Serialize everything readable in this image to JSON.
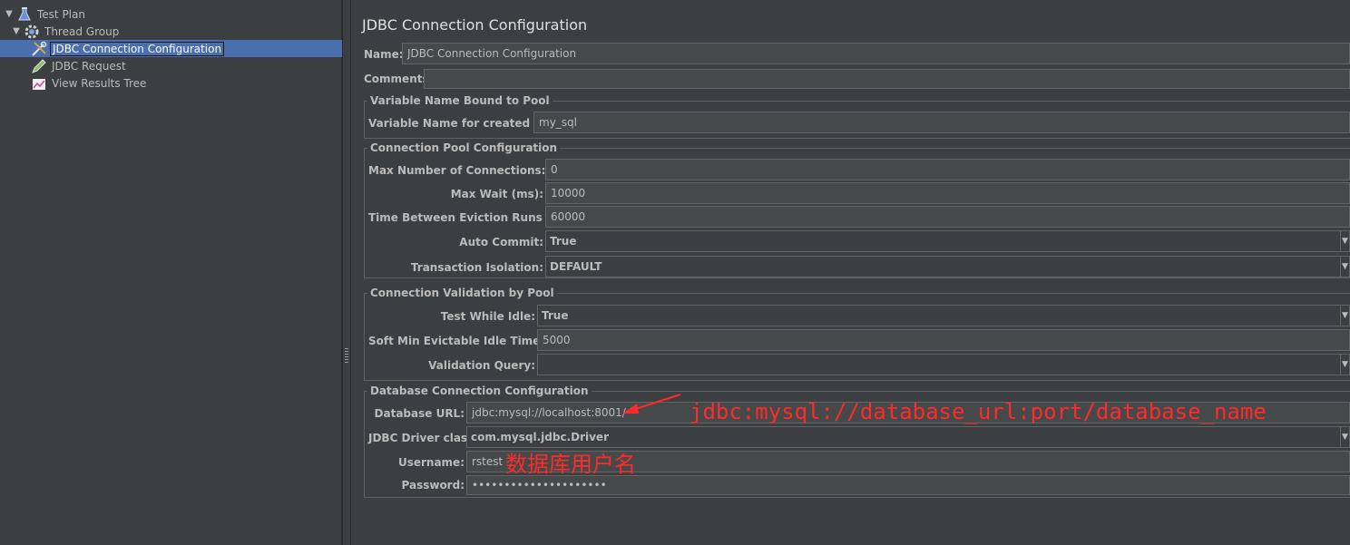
{
  "tree": {
    "items": [
      {
        "label": "Test Plan",
        "icon": "flask-icon",
        "expanded": true
      },
      {
        "label": "Thread Group",
        "icon": "gear-icon",
        "expanded": true
      },
      {
        "label": "JDBC Connection Configuration",
        "icon": "wrench-icon",
        "selected": true
      },
      {
        "label": "JDBC Request",
        "icon": "pen-icon"
      },
      {
        "label": "View Results Tree",
        "icon": "chart-icon"
      }
    ]
  },
  "config": {
    "title": "JDBC Connection Configuration",
    "name_label": "Name:",
    "name_value": "JDBC Connection Configuration",
    "comments_label": "Comments:",
    "comments_value": "",
    "var_group": {
      "title": "Variable Name Bound to Pool",
      "label": "Variable Name for created pool:",
      "value": "my_sql"
    },
    "pool_group": {
      "title": "Connection Pool Configuration",
      "max_conn_label": "Max Number of Connections:",
      "max_conn_value": "0",
      "max_wait_label": "Max Wait (ms):",
      "max_wait_value": "10000",
      "eviction_label": "Time Between Eviction Runs (ms):",
      "eviction_value": "60000",
      "autocommit_label": "Auto Commit:",
      "autocommit_value": "True",
      "isolation_label": "Transaction Isolation:",
      "isolation_value": "DEFAULT"
    },
    "validation_group": {
      "title": "Connection Validation by Pool",
      "idle_label": "Test While Idle:",
      "idle_value": "True",
      "evictable_label": "Soft Min Evictable Idle Time(ms):",
      "evictable_value": "5000",
      "query_label": "Validation Query:",
      "query_value": ""
    },
    "db_group": {
      "title": "Database Connection Configuration",
      "url_label": "Database URL:",
      "url_value": "jdbc:mysql://localhost:8001/",
      "driver_label": "JDBC Driver class:",
      "driver_value": "com.mysql.jdbc.Driver",
      "username_label": "Username:",
      "username_value": "rstest",
      "password_label": "Password:",
      "password_value": "•••••••••••••••••••••"
    }
  },
  "annotations": {
    "url_hint": "jdbc:mysql://database_url:port/database_name",
    "username_hint": "数据库用户名",
    "color": "#ff2a2a"
  },
  "colors": {
    "background": "#3c3f41",
    "selection": "#4b6eaf",
    "field": "#45494a"
  }
}
